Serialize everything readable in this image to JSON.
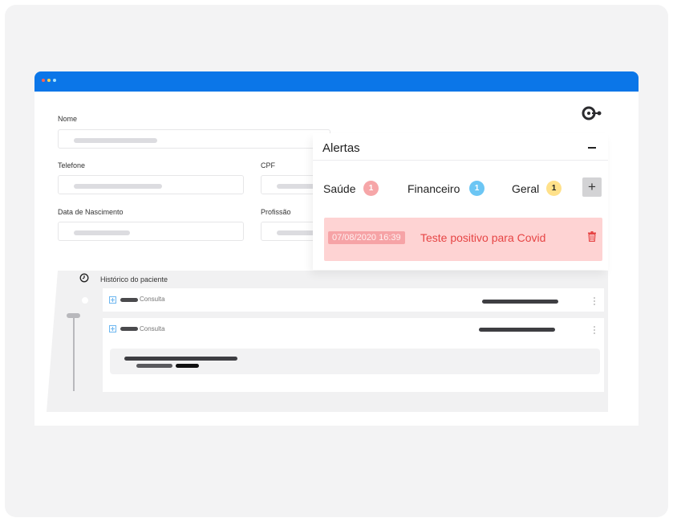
{
  "form": {
    "nome_label": "Nome",
    "telefone_label": "Telefone",
    "cpf_label": "CPF",
    "nascimento_label": "Data de Nascimento",
    "profissao_label": "Profissão"
  },
  "history": {
    "title": "Histórico do paciente",
    "entries": [
      {
        "type": "Consulta"
      },
      {
        "type": "Consulta"
      }
    ]
  },
  "alerts": {
    "title": "Alertas",
    "categories": [
      {
        "label": "Saúde",
        "count": "1",
        "color": "#f6a6a8"
      },
      {
        "label": "Financeiro",
        "count": "1",
        "color": "#6cc6f4"
      },
      {
        "label": "Geral",
        "count": "1",
        "color": "#ffe18a"
      }
    ],
    "add_label": "+",
    "items": [
      {
        "date": "07/08/2020 16:39",
        "text": "Teste positivo para Covid"
      }
    ]
  },
  "colors": {
    "titlebar": "#0b76e8",
    "alert_bg": "#fed3d3",
    "alert_text": "#e64545"
  },
  "icons": [
    "clock-icon",
    "plus-square-icon",
    "kebab-icon",
    "trash-icon",
    "logo-icon"
  ]
}
